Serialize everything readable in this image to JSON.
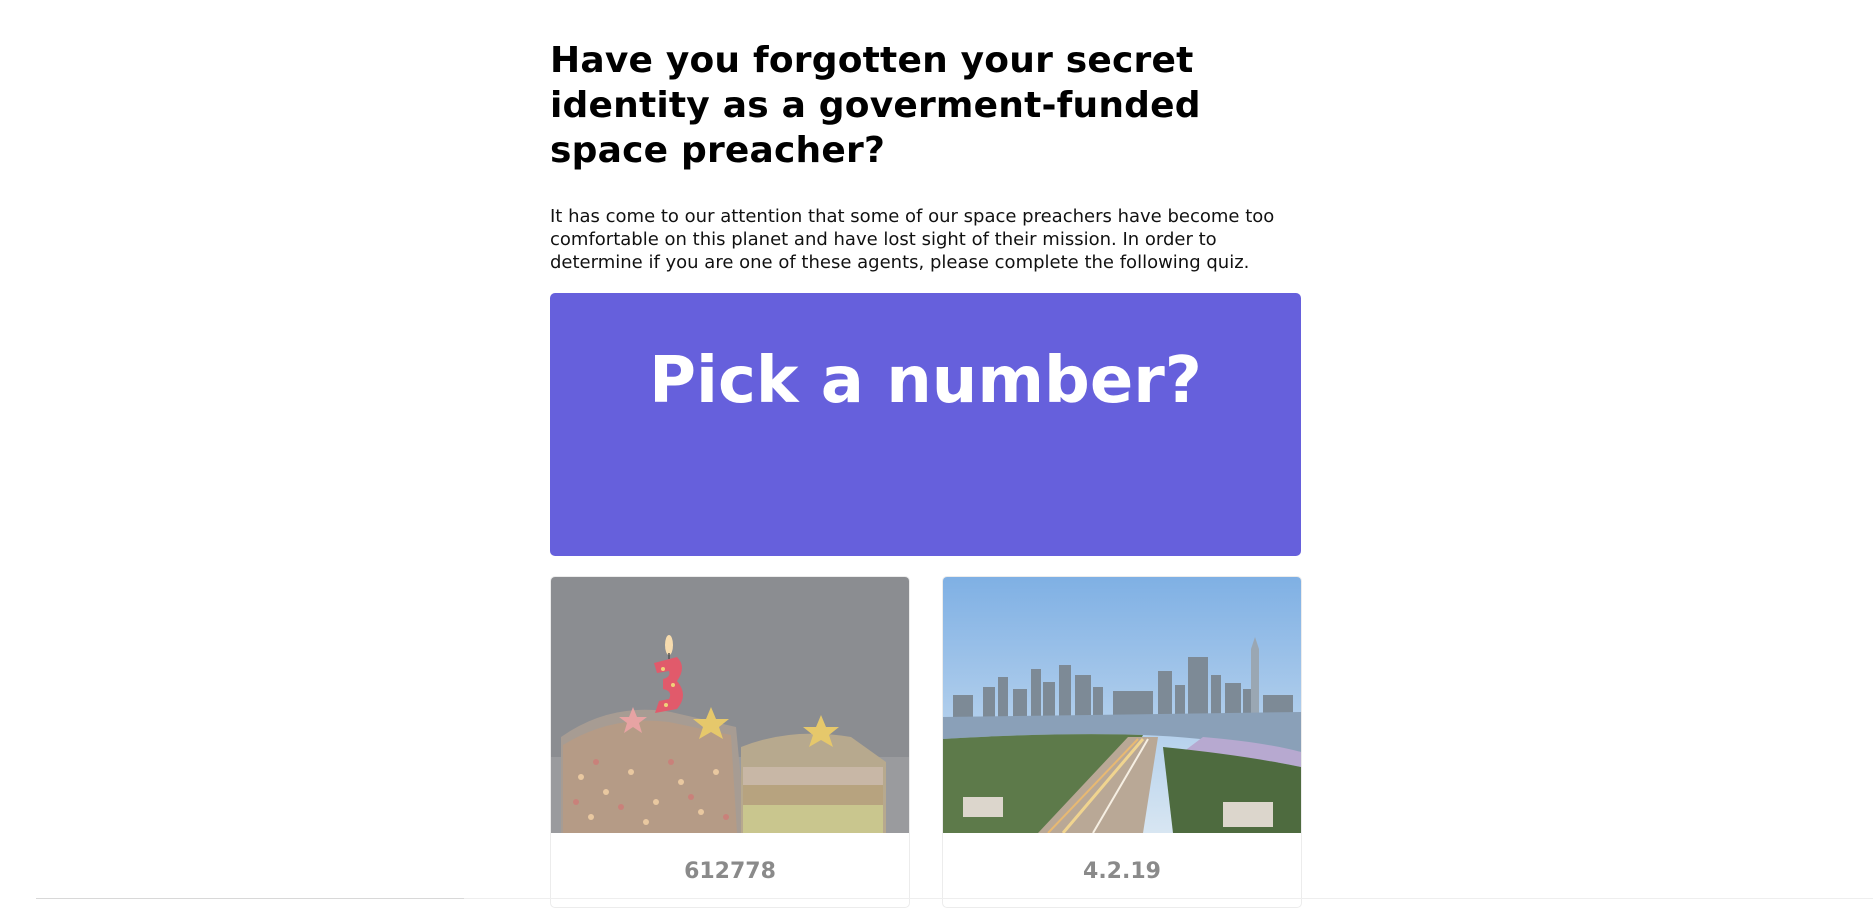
{
  "quiz": {
    "title": "Have you forgotten your secret identity as a goverment-funded space preacher?",
    "intro": "It has come to our attention that some of our space preachers have become too comfortable on this planet and have lost sight of their mission. In order to determine if you are one of these agents, please complete the following quiz.",
    "question": "Pick a number?",
    "options": [
      {
        "label": "612778",
        "image": "birthday-cake-candle-3-photo"
      },
      {
        "label": "4.2.19",
        "image": "city-skyline-river-photo"
      }
    ]
  },
  "colors": {
    "question_bg": "#6660dc",
    "option_label": "#8a8a8a"
  }
}
